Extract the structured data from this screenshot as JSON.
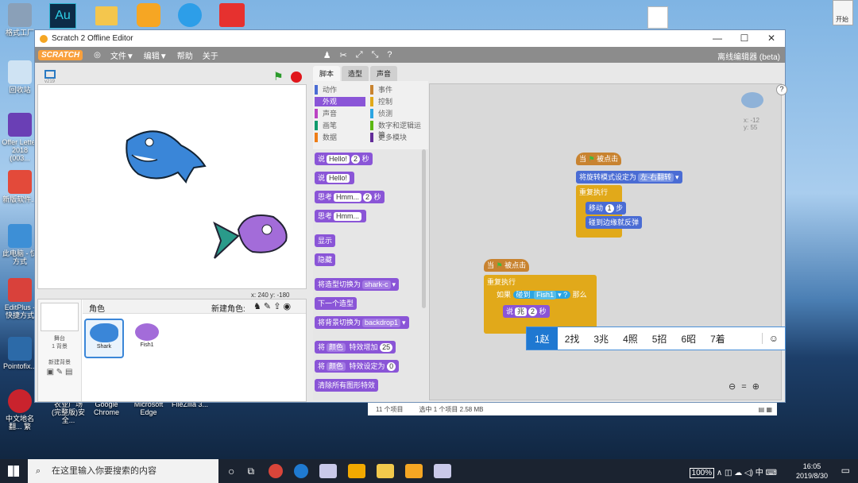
{
  "desktop": {
    "icons": [
      {
        "label": "格式工厂"
      },
      {
        "label": ""
      },
      {
        "label": ""
      },
      {
        "label": ""
      },
      {
        "label": ""
      },
      {
        "label": ""
      },
      {
        "label": "回收站"
      },
      {
        "label": "Offer Letter 2018 (003..."
      },
      {
        "label": "新版软件..."
      },
      {
        "label": "此电脑 - 快方式"
      },
      {
        "label": "EditPlus - 快捷方式"
      },
      {
        "label": "Pointofix..."
      },
      {
        "label": "中文地名翻... 繁"
      }
    ],
    "bottom_icons": [
      "农业广场 (完整版)安全...",
      "Google Chrome",
      "Microsoft Edge",
      "FileZilla 3..."
    ],
    "tray_button": "开始"
  },
  "window": {
    "title": "Scratch 2 Offline Editor",
    "controls": [
      "—",
      "☐",
      "✕"
    ]
  },
  "menubar": {
    "brand": "SCRATCH",
    "items": [
      "文件▼",
      "编辑▼",
      "帮助",
      "关于"
    ],
    "right_label": "离线编辑器 (beta)"
  },
  "stage": {
    "version": "v219",
    "coords": "x: 240  y: -180"
  },
  "sprites": {
    "header": "角色",
    "new_sprite": "新建角色:",
    "stage_label": "舞台",
    "stage_sub": "1 背景",
    "new_backdrop": "新建背景",
    "items": [
      "Shark",
      "Fish1"
    ]
  },
  "tabs": [
    "脚本",
    "造型",
    "声音"
  ],
  "categories": [
    {
      "label": "动作",
      "color": "#4a6cd4"
    },
    {
      "label": "事件",
      "color": "#c88330"
    },
    {
      "label": "外观",
      "color": "#8a55d7"
    },
    {
      "label": "控制",
      "color": "#e1a91a"
    },
    {
      "label": "声音",
      "color": "#bb42c3"
    },
    {
      "label": "侦测",
      "color": "#2ca5e2"
    },
    {
      "label": "画笔",
      "color": "#0e9a6c"
    },
    {
      "label": "数字和逻辑运算",
      "color": "#5cb712"
    },
    {
      "label": "数据",
      "color": "#ee7d16"
    },
    {
      "label": "更多模块",
      "color": "#632d99"
    }
  ],
  "palette": [
    {
      "parts": [
        "说",
        "Hello!",
        "2",
        "秒"
      ]
    },
    {
      "parts": [
        "说",
        "Hello!"
      ]
    },
    {
      "parts": [
        "思考",
        "Hmm...",
        "2",
        "秒"
      ]
    },
    {
      "parts": [
        "思考",
        "Hmm..."
      ]
    },
    {
      "parts": [
        "显示"
      ]
    },
    {
      "parts": [
        "隐藏"
      ]
    },
    {
      "parts": [
        "将造型切换为",
        "shark-c"
      ]
    },
    {
      "parts": [
        "下一个造型"
      ]
    },
    {
      "parts": [
        "将背景切换为",
        "backdrop1"
      ]
    },
    {
      "parts": [
        "将",
        "颜色",
        "特效增加",
        "25"
      ]
    },
    {
      "parts": [
        "将",
        "颜色",
        "特效设定为",
        "0"
      ]
    },
    {
      "parts": [
        "清除所有图形特效"
      ]
    }
  ],
  "scripts": {
    "sprite_x": "x: -12",
    "sprite_y": "y: 55",
    "script1": {
      "hat": [
        "当",
        "被点击"
      ],
      "rotation": [
        "将旋转模式设定为",
        "左-右翻转"
      ],
      "forever": "重复执行",
      "move": [
        "移动",
        "1",
        "步"
      ],
      "bounce": "碰到边缘就反弹"
    },
    "script2": {
      "hat": [
        "当",
        "被点击"
      ],
      "forever": "重复执行",
      "if": [
        "如果",
        "碰到",
        "Fish1",
        "?",
        "那么"
      ],
      "say": [
        "说",
        "兆",
        "2",
        "秒"
      ]
    }
  },
  "ime": {
    "candidates": [
      "1赵",
      "2找",
      "3兆",
      "4照",
      "5招",
      "6昭",
      "7着"
    ]
  },
  "statusbar": {
    "count": "11 个项目",
    "selected": "选中 1 个项目  2.58 MB"
  },
  "taskbar": {
    "search_placeholder": "在这里输入你要搜索的内容",
    "battery": "100%",
    "lang": "中",
    "time": "16:05",
    "date": "2019/8/30"
  }
}
